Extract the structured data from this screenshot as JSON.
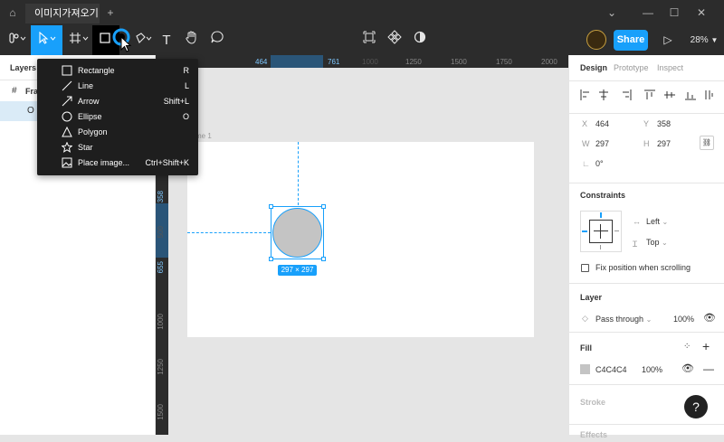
{
  "titlebar": {
    "tab_title": "이미지가져오기",
    "new_tab": "+",
    "minimize": "⌄",
    "min": "—",
    "max": "☐",
    "close": "✕"
  },
  "toolbar": {
    "share_label": "Share",
    "zoom": "28%",
    "text_tool": "T"
  },
  "tool_menu": {
    "items": [
      {
        "label": "Rectangle",
        "shortcut": "R"
      },
      {
        "label": "Line",
        "shortcut": "L"
      },
      {
        "label": "Arrow",
        "shortcut": "Shift+L"
      },
      {
        "label": "Ellipse",
        "shortcut": "O"
      },
      {
        "label": "Polygon",
        "shortcut": ""
      },
      {
        "label": "Star",
        "shortcut": ""
      },
      {
        "label": "Place image...",
        "shortcut": "Ctrl+Shift+K"
      }
    ]
  },
  "layers": {
    "title": "Layers",
    "frame_item": "Fra",
    "ellipse_icon": "O"
  },
  "rulers": {
    "h": [
      "464",
      "761",
      "1000",
      "1250",
      "1500",
      "1750",
      "2000"
    ],
    "v": [
      "358",
      "500",
      "655",
      "1000",
      "1250",
      "1500"
    ]
  },
  "canvas": {
    "frame_label": "me 1",
    "size_badge": "297 × 297"
  },
  "design": {
    "tabs": [
      "Design",
      "Prototype",
      "Inspect"
    ],
    "x_label": "X",
    "x_val": "464",
    "y_label": "Y",
    "y_val": "358",
    "w_label": "W",
    "w_val": "297",
    "h_label": "H",
    "h_val": "297",
    "rot_val": "0°",
    "constraints_title": "Constraints",
    "constraint_h": "Left",
    "constraint_v": "Top",
    "fix_position": "Fix position when scrolling",
    "layer_title": "Layer",
    "blend": "Pass through",
    "opacity": "100%",
    "fill_title": "Fill",
    "fill_hex": "C4C4C4",
    "fill_opacity": "100%",
    "stroke_title": "Stroke",
    "effects_title": "Effects"
  },
  "colors": {
    "accent": "#18a0fb",
    "toolbar_bg": "#2c2c2c",
    "fill": "#c4c4c4"
  },
  "help": "?"
}
